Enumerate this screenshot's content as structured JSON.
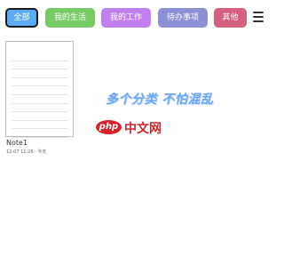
{
  "tabs": [
    {
      "label": "全部",
      "color": "#5aabf5",
      "active": true
    },
    {
      "label": "我的生活",
      "color": "#77cc66"
    },
    {
      "label": "我的工作",
      "color": "#c17ff0"
    },
    {
      "label": "待办事项",
      "color": "#8c8fd6"
    },
    {
      "label": "其他",
      "color": "#d6607f"
    }
  ],
  "menu_icon": "hamburger-menu-icon",
  "notes": [
    {
      "title": "Note1",
      "meta": "12-07 11:26 · 今天"
    }
  ],
  "banner": "多个分类 不怕混乱",
  "watermark": {
    "badge": "php",
    "text": "中文网"
  }
}
